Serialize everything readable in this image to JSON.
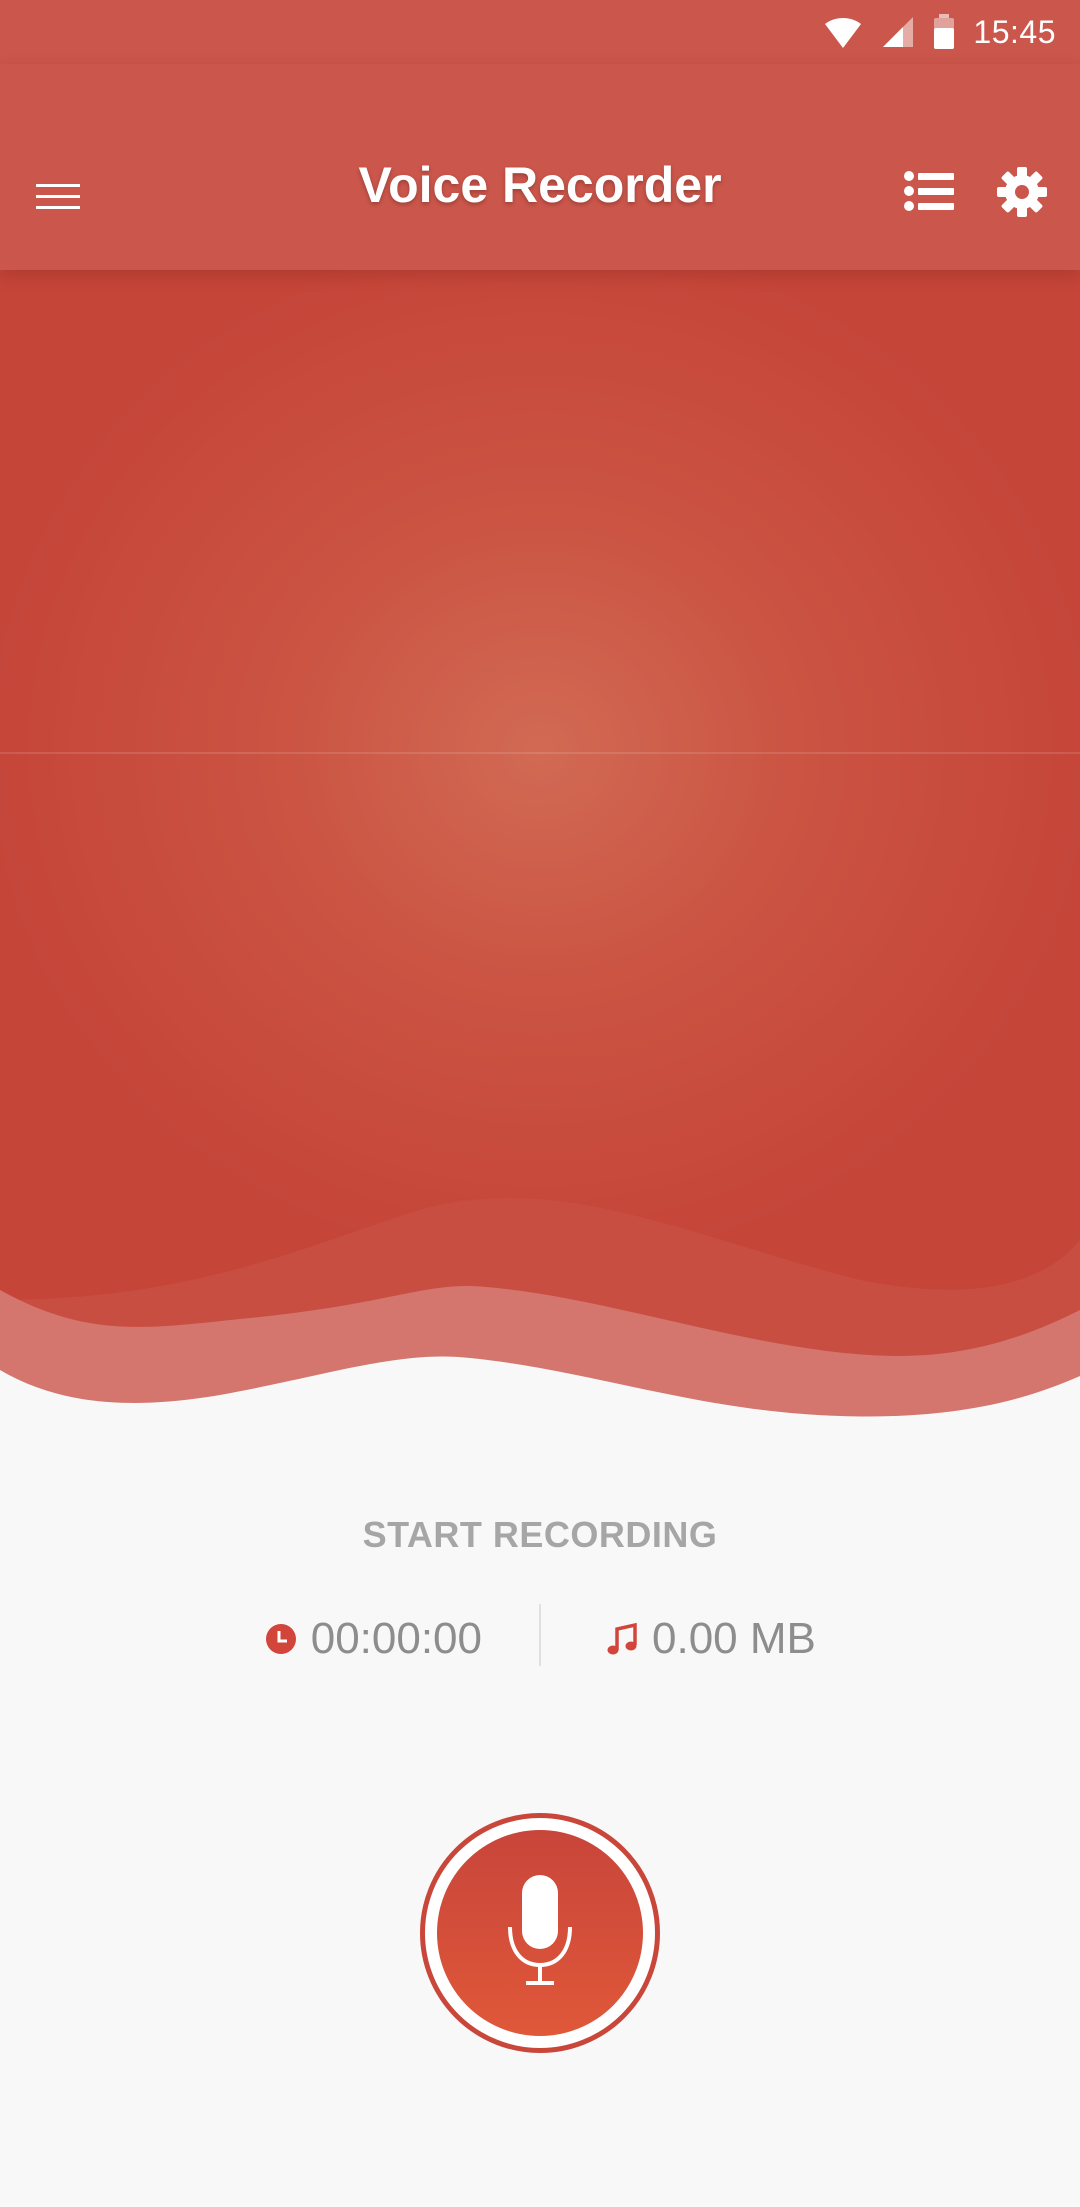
{
  "status_bar": {
    "time": "15:45",
    "icons": [
      "wifi-icon",
      "signal-icon",
      "battery-icon"
    ]
  },
  "app_bar": {
    "title": "Voice Recorder",
    "icons": [
      "menu-icon",
      "list-icon",
      "gear-icon"
    ]
  },
  "recorder": {
    "status_label": "START RECORDING",
    "elapsed_time": "00:00:00",
    "file_size": "0.00 MB",
    "icons": [
      "clock-icon",
      "music-note-icon",
      "microphone-icon"
    ]
  },
  "colors": {
    "primary": "#cb564b",
    "accent": "#c9473a",
    "text_muted": "#a6a6a6",
    "background": "#f8f8f8"
  }
}
